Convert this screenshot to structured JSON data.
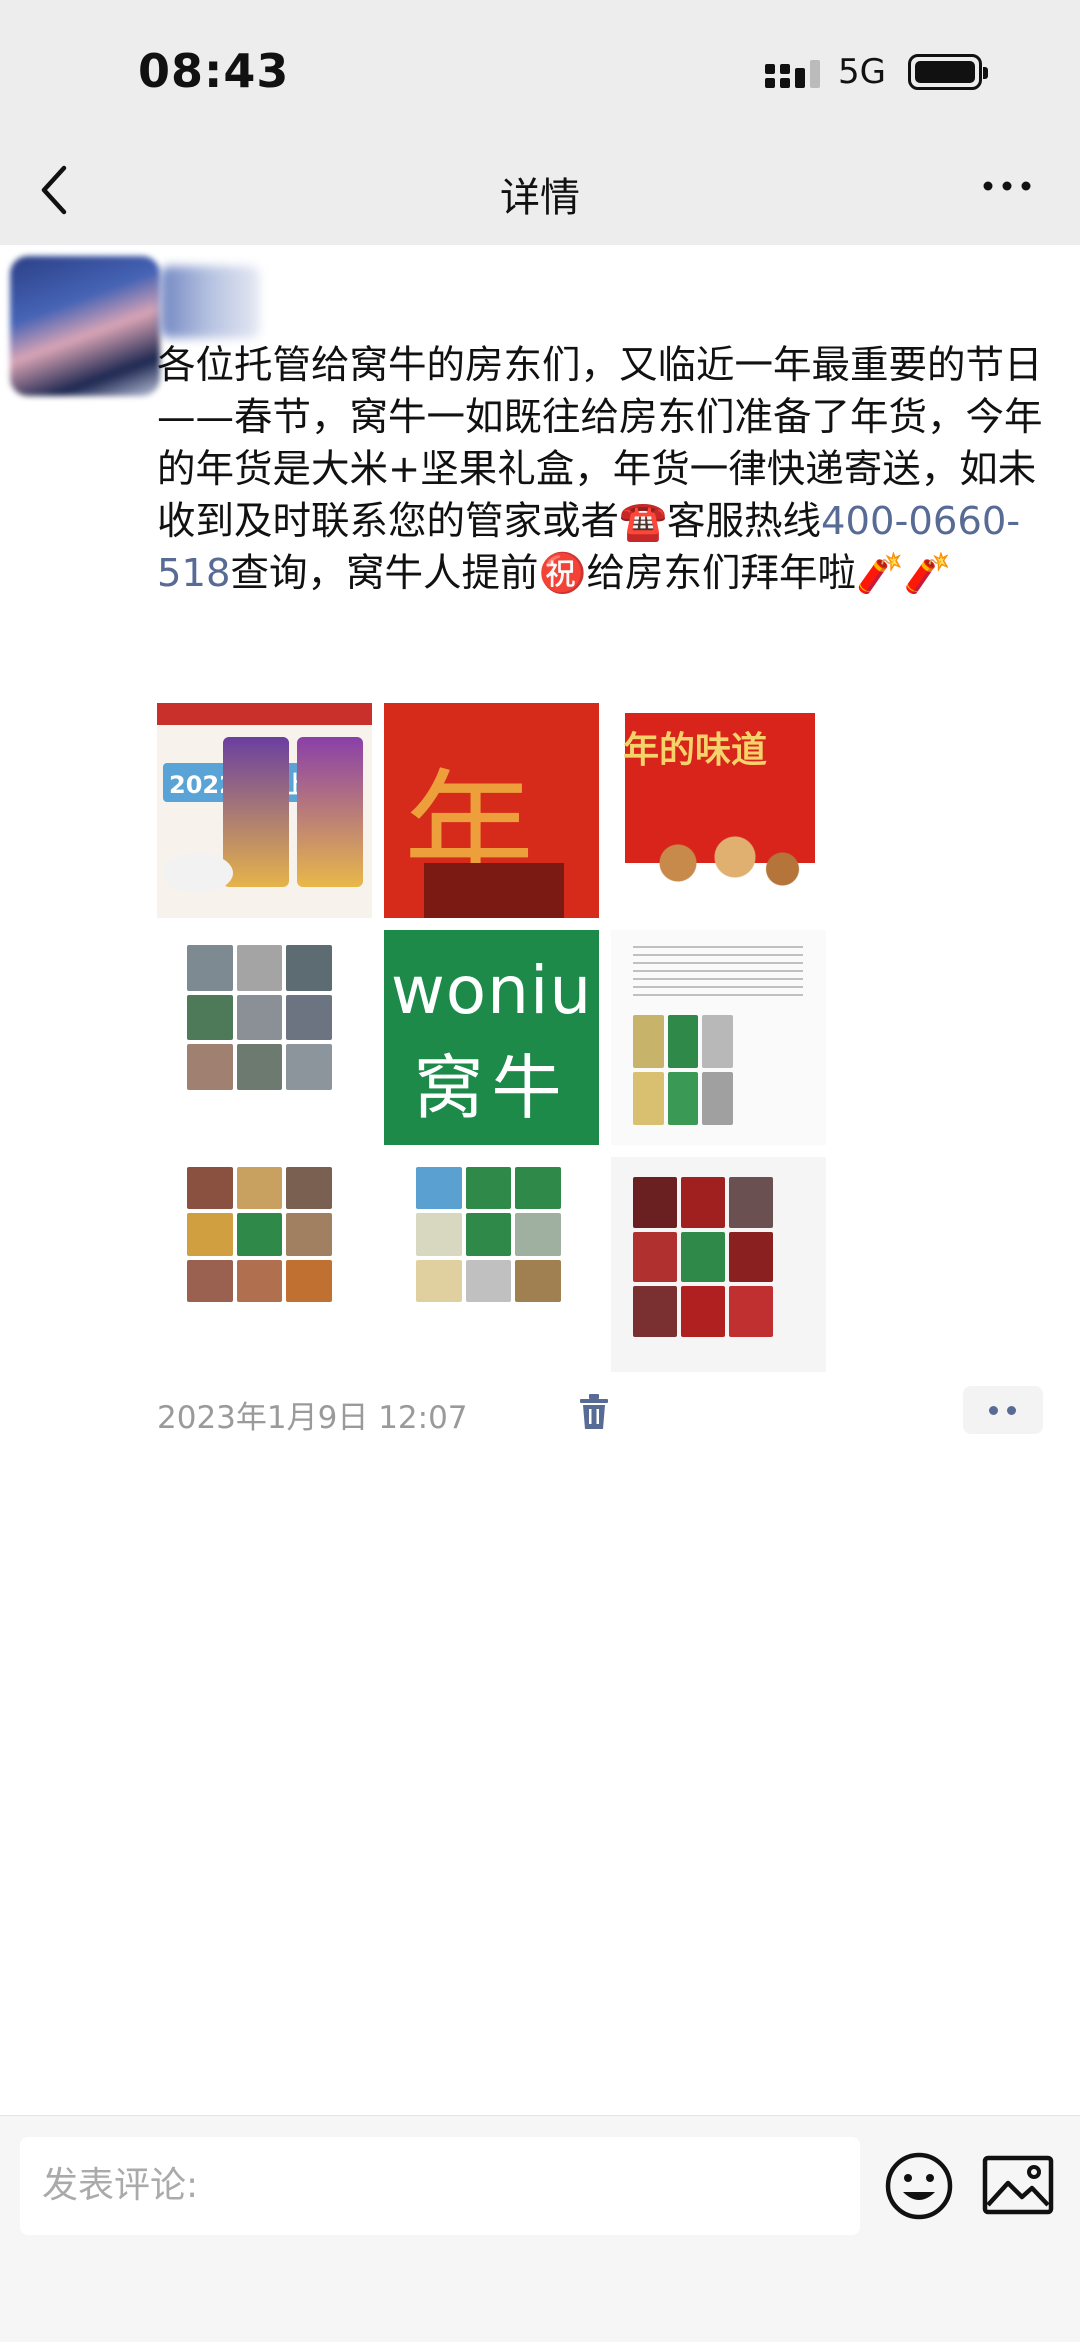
{
  "status_bar": {
    "time": "08:43",
    "network": "5G"
  },
  "nav": {
    "title": "详情"
  },
  "post": {
    "text_before_phone": "各位托管给窝牛的房东们，又临近一年最重要的节日——春节，窝牛一如既往给房东们准备了年货，今年的年货是大米+坚果礼盒，年货一律快递寄送，如未收到及时联系您的管家或者☎️客服热线",
    "phone": "400-0660-518",
    "text_after_phone": "查询，窝牛人提前㊗️给房东们拜年啦🧨🧨",
    "timestamp": "2023年1月9日 12:07"
  },
  "images": {
    "gift_box_text": "年的味道",
    "rice_badge": "2022新米上市",
    "nian_char": "年",
    "brand_en": "woniu",
    "brand_cn": "窝牛"
  },
  "comment": {
    "placeholder": "发表评论:"
  },
  "colors": {
    "link": "#576b95",
    "brand_green": "#1e8a4a",
    "festive_red": "#d62a1a"
  }
}
